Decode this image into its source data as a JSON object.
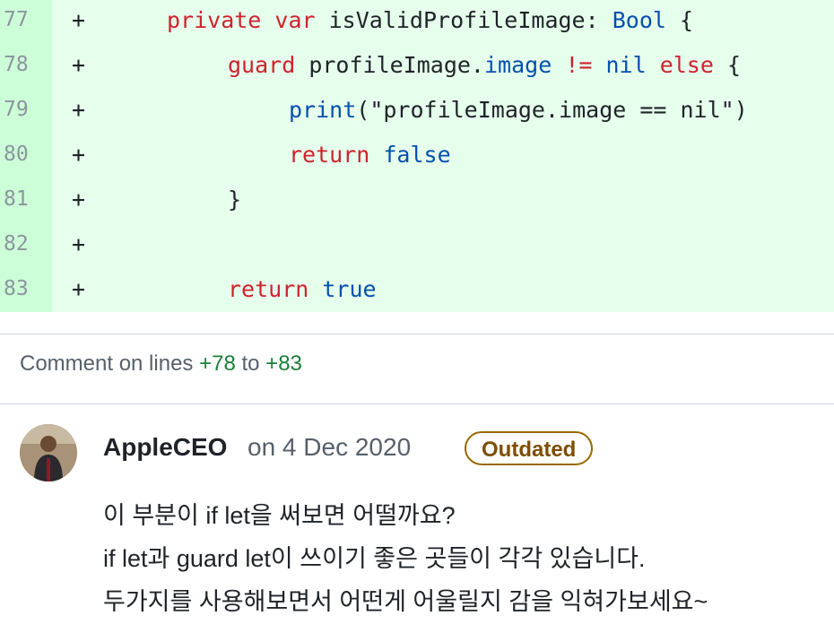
{
  "diff": {
    "lines": [
      {
        "num": "77",
        "sign": "+"
      },
      {
        "num": "78",
        "sign": "+"
      },
      {
        "num": "79",
        "sign": "+"
      },
      {
        "num": "80",
        "sign": "+"
      },
      {
        "num": "81",
        "sign": "+"
      },
      {
        "num": "82",
        "sign": "+"
      },
      {
        "num": "83",
        "sign": "+"
      }
    ],
    "code": {
      "l77": {
        "private": "private",
        "var": "var",
        "name": " isValidProfileImage: ",
        "type": "Bool",
        "brace": " {"
      },
      "l78": {
        "guard": "guard",
        "obj": " profileImage.",
        "prop": "image",
        "neq": "!=",
        "nil": "nil",
        "else": "else",
        "brace": " {"
      },
      "l79": {
        "print": "print",
        "arg": "(\"profileImage.image == nil\")"
      },
      "l80": {
        "return": "return",
        "false": "false"
      },
      "l81": {
        "brace": "}"
      },
      "l83": {
        "return": "return",
        "true": "true"
      }
    }
  },
  "comment_header": {
    "prefix": "Comment on lines ",
    "from": "+78",
    "to_word": " to ",
    "to": "+83"
  },
  "comment": {
    "author": "AppleCEO",
    "date": "on 4 Dec 2020",
    "badge": "Outdated",
    "body": [
      "이 부분이 if let을 써보면 어떨까요?",
      "if let과 guard let이 쓰이기 좋은 곳들이 각각 있습니다.",
      "두가지를 사용해보면서 어떤게 어울릴지 감을 익혀가보세요~"
    ]
  },
  "colors": {
    "added_bg": "#e6ffec",
    "gutter_bg": "#ccffd8",
    "keyword": "#cf222e",
    "type_blue": "#0550ae",
    "line_ref_green": "#1a7f37",
    "badge_brown": "#9a6700"
  }
}
